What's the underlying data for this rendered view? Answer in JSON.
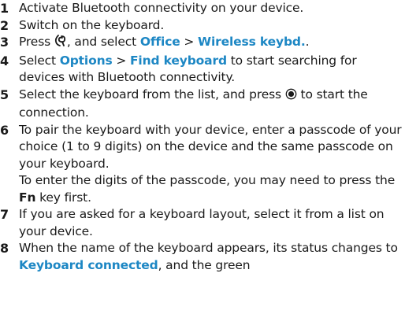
{
  "steps": [
    {
      "number": "1",
      "text": "Activate Bluetooth connectivity on your device."
    },
    {
      "number": "2",
      "text": "Switch on the keyboard."
    },
    {
      "number": "3",
      "t1": "Press",
      "t2": ", and select",
      "ui1": "Office",
      "sep": ">",
      "ui2": "Wireless keybd.",
      "end": ".",
      "icon": "menu-key-icon"
    },
    {
      "number": "4",
      "t1": "Select",
      "ui1": "Options",
      "sep": ">",
      "ui2": "Find keyboard",
      "t2": "to start searching for devices with Bluetooth connectivity."
    },
    {
      "number": "5",
      "t1": "Select the keyboard from the list, and press",
      "t2": "to start the connection.",
      "icon": "scroll-key-icon"
    },
    {
      "number": "6",
      "text": "To pair the keyboard with your device, enter a passcode of your choice (1 to 9 digits) on the device and the same passcode on your keyboard.",
      "extra_t1": "To enter the digits of the passcode, you may need to press the",
      "extra_key": "Fn",
      "extra_t2": "key first."
    },
    {
      "number": "7",
      "text": "If you are asked for a keyboard layout, select it from a list on your device."
    },
    {
      "number": "8",
      "t1": "When the name of the keyboard appears, its status changes to",
      "ui1": "Keyboard connected",
      "t2": ", and the green"
    }
  ]
}
